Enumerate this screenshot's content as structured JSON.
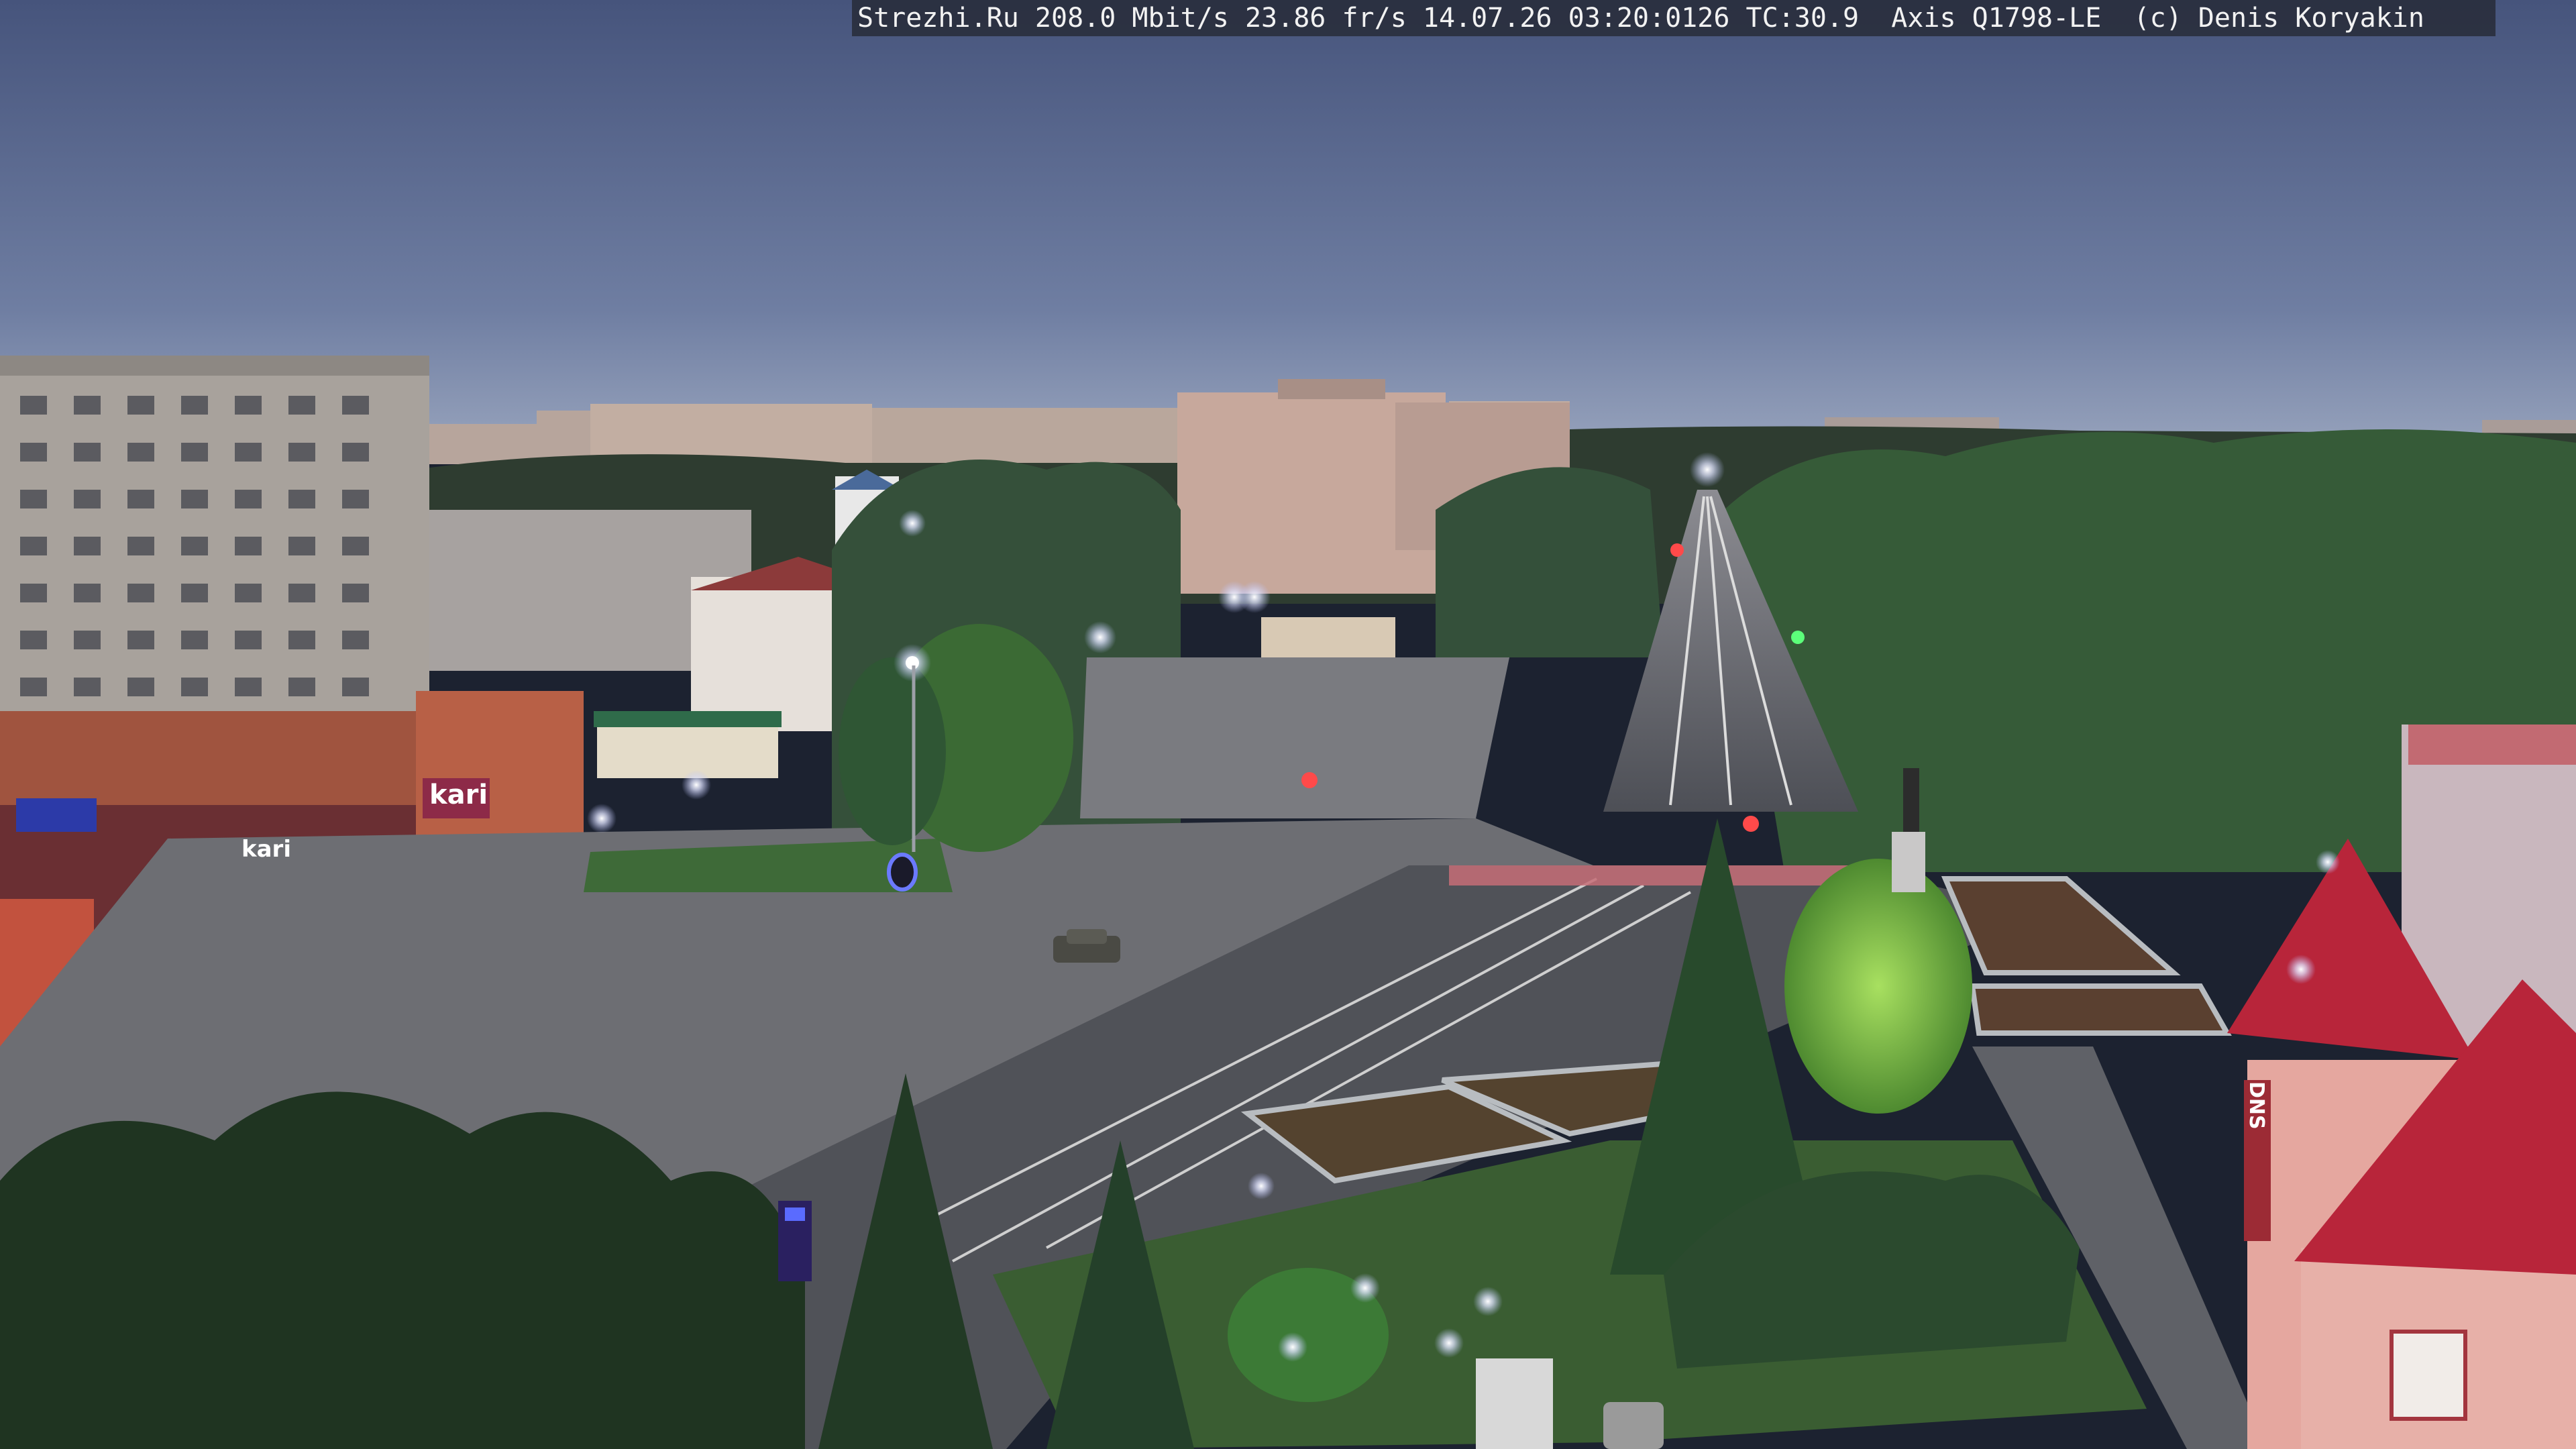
{
  "camera": {
    "overlay_text": "Strezhi.Ru 208.0 Mbit/s 23.86 fr/s 14.07.26 03:20:0126 TC:30.9  Axis Q1798-LE  (c) Denis Koryakin"
  },
  "signs": {
    "store_logo": "kari",
    "store_logo_small": "kari",
    "tower_sign": "DNS"
  },
  "colors": {
    "sky_top": "#4c5a82",
    "sky_horizon": "#8d9ab5",
    "grass": "#3f5a34",
    "road": "#55575e",
    "street_light": "#e6e9ff",
    "tower_roof": "#b8253a",
    "tower_wall": "#e6a8a0"
  }
}
